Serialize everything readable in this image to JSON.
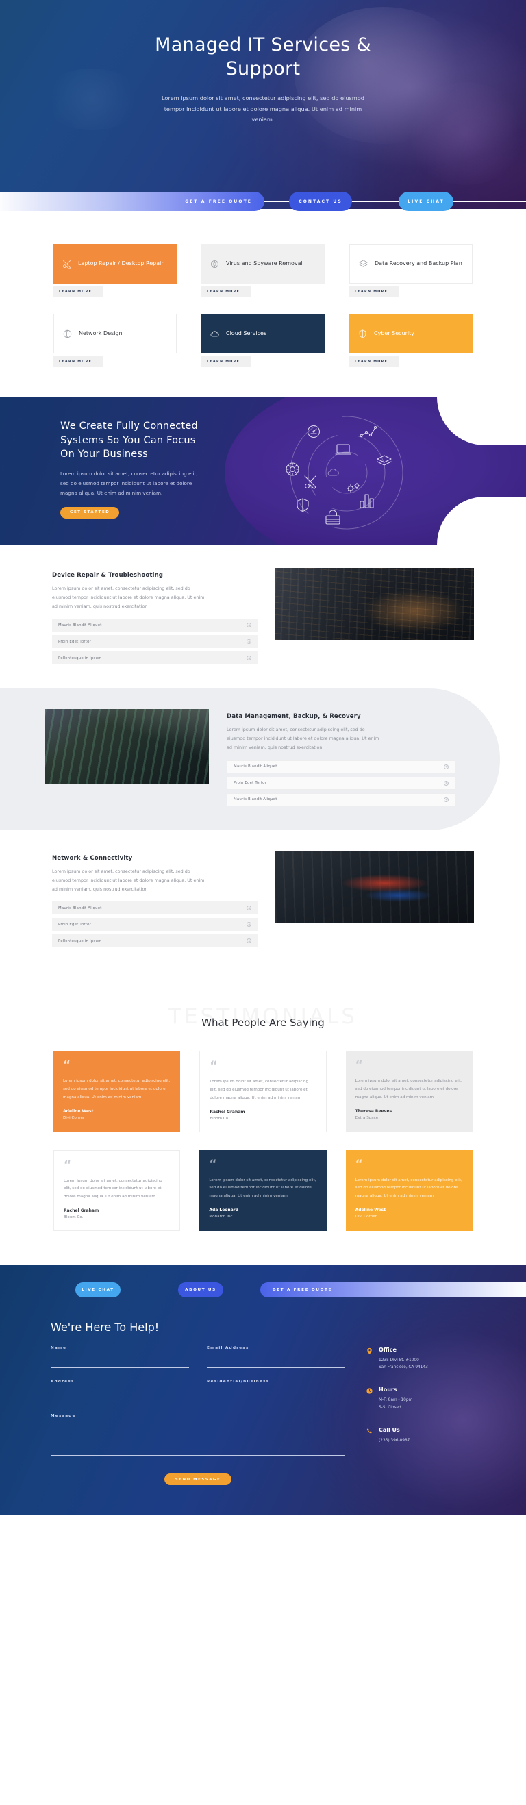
{
  "hero": {
    "title": "Managed IT Services & Support",
    "subtitle": "Lorem ipsum dolor sit amet, consectetur adipiscing elit, sed do eiusmod tempor incididunt ut labore et dolore magna aliqua. Ut enim ad minim veniam.",
    "cta": {
      "quote": "GET A FREE QUOTE",
      "contact": "CONTACT US",
      "live_chat": "LIVE CHAT"
    }
  },
  "services": {
    "learn_more": "LEARN MORE",
    "items": [
      {
        "label": "Laptop Repair / Desktop Repair",
        "icon": "wrench-screwdriver-icon",
        "style": "orange"
      },
      {
        "label": "Virus and Spyware Removal",
        "icon": "virus-icon",
        "style": "grey"
      },
      {
        "label": "Data Recovery and Backup Plan",
        "icon": "layers-icon",
        "style": "white"
      },
      {
        "label": "Network Design",
        "icon": "globe-icon",
        "style": "white"
      },
      {
        "label": "Cloud Services",
        "icon": "cloud-icon",
        "style": "navy"
      },
      {
        "label": "Cyber Security",
        "icon": "shield-icon",
        "style": "yellow"
      }
    ]
  },
  "feature": {
    "title": "We Create Fully Connected Systems So You Can Focus On Your Business",
    "text": "Lorem ipsum dolor sit amet, consectetur adipiscing elit, sed do eiusmod tempor incididunt ut labore et dolore magna aliqua. Ut enim ad minim veniam.",
    "button": "GET STARTED",
    "ring_icons": [
      "gauge-icon",
      "line-chart-icon",
      "laptop-icon",
      "layers-icon",
      "virus-icon",
      "wrench-icon",
      "cloud-icon",
      "gears-icon",
      "shield-icon",
      "bar-chart-icon",
      "lock-icon"
    ]
  },
  "blocks": [
    {
      "title": "Device Repair & Troubleshooting",
      "text": "Lorem ipsum dolor sit amet, consectetur adipiscing elit, sed do eiusmod tempor incididunt ut labore et dolore magna aliqua. Ut enim ad minim veniam, quis nostrud exercitation",
      "accordion": [
        "Mauris Blandit Aliquet",
        "Proin Eget Tortor",
        "Pellentesque in Ipsum"
      ],
      "image": "circuit-board-photo"
    },
    {
      "title": "Data Management, Backup, & Recovery",
      "text": "Lorem ipsum dolor sit amet, consectetur adipiscing elit, sed do eiusmod tempor incididunt ut labore et dolore magna aliqua. Ut enim ad minim veniam, quis nostrud exercitation",
      "accordion": [
        "Mauris Blandit Aliquet",
        "Proin Eget Tortor",
        "Mauris Blandit Aliquet"
      ],
      "image": "memory-module-photo"
    },
    {
      "title": "Network & Connectivity",
      "text": "Lorem ipsum dolor sit amet, consectetur adipiscing elit, sed do eiusmod tempor incididunt ut labore et dolore magna aliqua. Ut enim ad minim veniam, quis nostrud exercitation",
      "accordion": [
        "Mauris Blandit Aliquet",
        "Proin Eget Tortor",
        "Pellentesque in Ipsum"
      ],
      "image": "network-cables-photo"
    }
  ],
  "testimonials": {
    "watermark": "TESTIMONIALS",
    "title": "What People Are Saying",
    "quote_mark": "“",
    "cards": [
      {
        "text": "Lorem ipsum dolor sit amet, consectetur adipiscing elit, sed do eiusmod tempor incididunt ut labore et dolore magna aliqua. Ut enim ad minim veniam",
        "name": "Adeline West",
        "company": "Divi Corner",
        "style": "orange"
      },
      {
        "text": "Lorem ipsum dolor sit amet, consectetur adipiscing elit, sed do eiusmod tempor incididunt ut labore et dolore magna aliqua. Ut enim ad minim veniam",
        "name": "Rachel Graham",
        "company": "Bloom Co.",
        "style": "white"
      },
      {
        "text": "Lorem ipsum dolor sit amet, consectetur adipiscing elit, sed do eiusmod tempor incididunt ut labore et dolore magna aliqua. Ut enim ad minim veniam",
        "name": "Theresa Reeves",
        "company": "Extra Space",
        "style": "grey"
      },
      {
        "text": "Lorem ipsum dolor sit amet, consectetur adipiscing elit, sed do eiusmod tempor incididunt ut labore et dolore magna aliqua. Ut enim ad minim veniam",
        "name": "Rachel Graham",
        "company": "Bloom Co.",
        "style": "white"
      },
      {
        "text": "Lorem ipsum dolor sit amet, consectetur adipiscing elit, sed do eiusmod tempor incididunt ut labore et dolore magna aliqua. Ut enim ad minim veniam",
        "name": "Ada Leonard",
        "company": "Monarch Inc",
        "style": "navy"
      },
      {
        "text": "Lorem ipsum dolor sit amet, consectetur adipiscing elit, sed do eiusmod tempor incididunt ut labore et dolore magna aliqua. Ut enim ad minim veniam",
        "name": "Adeline West",
        "company": "Divi Corner",
        "style": "yellow"
      }
    ]
  },
  "footer": {
    "bar": {
      "live_chat": "LIVE CHAT",
      "about_us": "ABOUT US",
      "quote": "GET A FREE QUOTE"
    },
    "heading": "We're Here To Help!",
    "fields": {
      "name": "Name",
      "email": "Email Address",
      "address": "Address",
      "type": "Residential/Business",
      "message": "Message"
    },
    "values": {
      "name": "",
      "email": "",
      "address": "",
      "type": "",
      "message": ""
    },
    "send": "SEND MESSAGE",
    "info": [
      {
        "icon": "map-pin-icon",
        "title": "Office",
        "line1": "1235 Divi St. #1000",
        "line2": "San Francisco, CA 94143"
      },
      {
        "icon": "clock-icon",
        "title": "Hours",
        "line1": "M-F: 8am - 10pm",
        "line2": "S-S: Closed"
      },
      {
        "icon": "phone-icon",
        "title": "Call Us",
        "line1": "(235) 396-0987",
        "line2": ""
      }
    ]
  },
  "colors": {
    "orange": "#f28b3c",
    "yellow": "#f9ae33",
    "navy": "#1c3553",
    "blue": "#3b57e0",
    "light_blue": "#45a6f0",
    "amber_btn": "#f2a030"
  }
}
